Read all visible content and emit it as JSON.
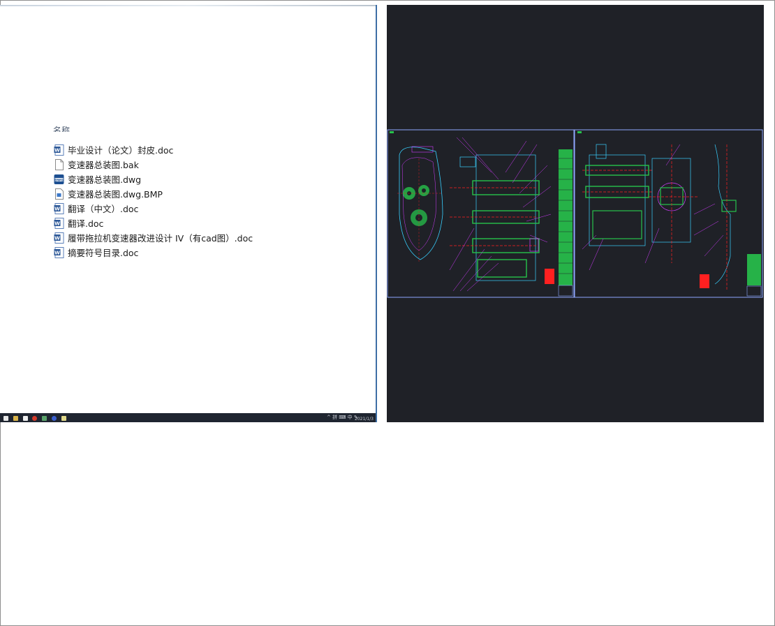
{
  "explorer": {
    "column_header": "名称",
    "files": [
      {
        "name": "毕业设计（论文）封皮.doc",
        "icon": "word-doc-icon"
      },
      {
        "name": "变速器总装图.bak",
        "icon": "blank-file-icon"
      },
      {
        "name": "变速器总装图.dwg",
        "icon": "dwg-file-icon"
      },
      {
        "name": "变速器总装图.dwg.BMP",
        "icon": "image-file-icon"
      },
      {
        "name": "翻译（中文）.doc",
        "icon": "word-doc-icon"
      },
      {
        "name": "翻译.doc",
        "icon": "word-doc-icon"
      },
      {
        "name": "履带拖拉机变速器改进设计 IV（有cad图）.doc",
        "icon": "word-doc-icon"
      },
      {
        "name": "摘要符号目录.doc",
        "icon": "word-doc-icon"
      }
    ],
    "taskbar": {
      "tray_text": "^ 拼 ⌨ 中 ✎",
      "clock": "2021/1/3"
    }
  },
  "cad_preview": {
    "background": "#1f2127",
    "accent_colors": {
      "outline": "#8fa8ff",
      "green": "#27c24c",
      "magenta": "#d23cff",
      "red": "#ff2020",
      "cyan": "#38d0ff"
    }
  }
}
